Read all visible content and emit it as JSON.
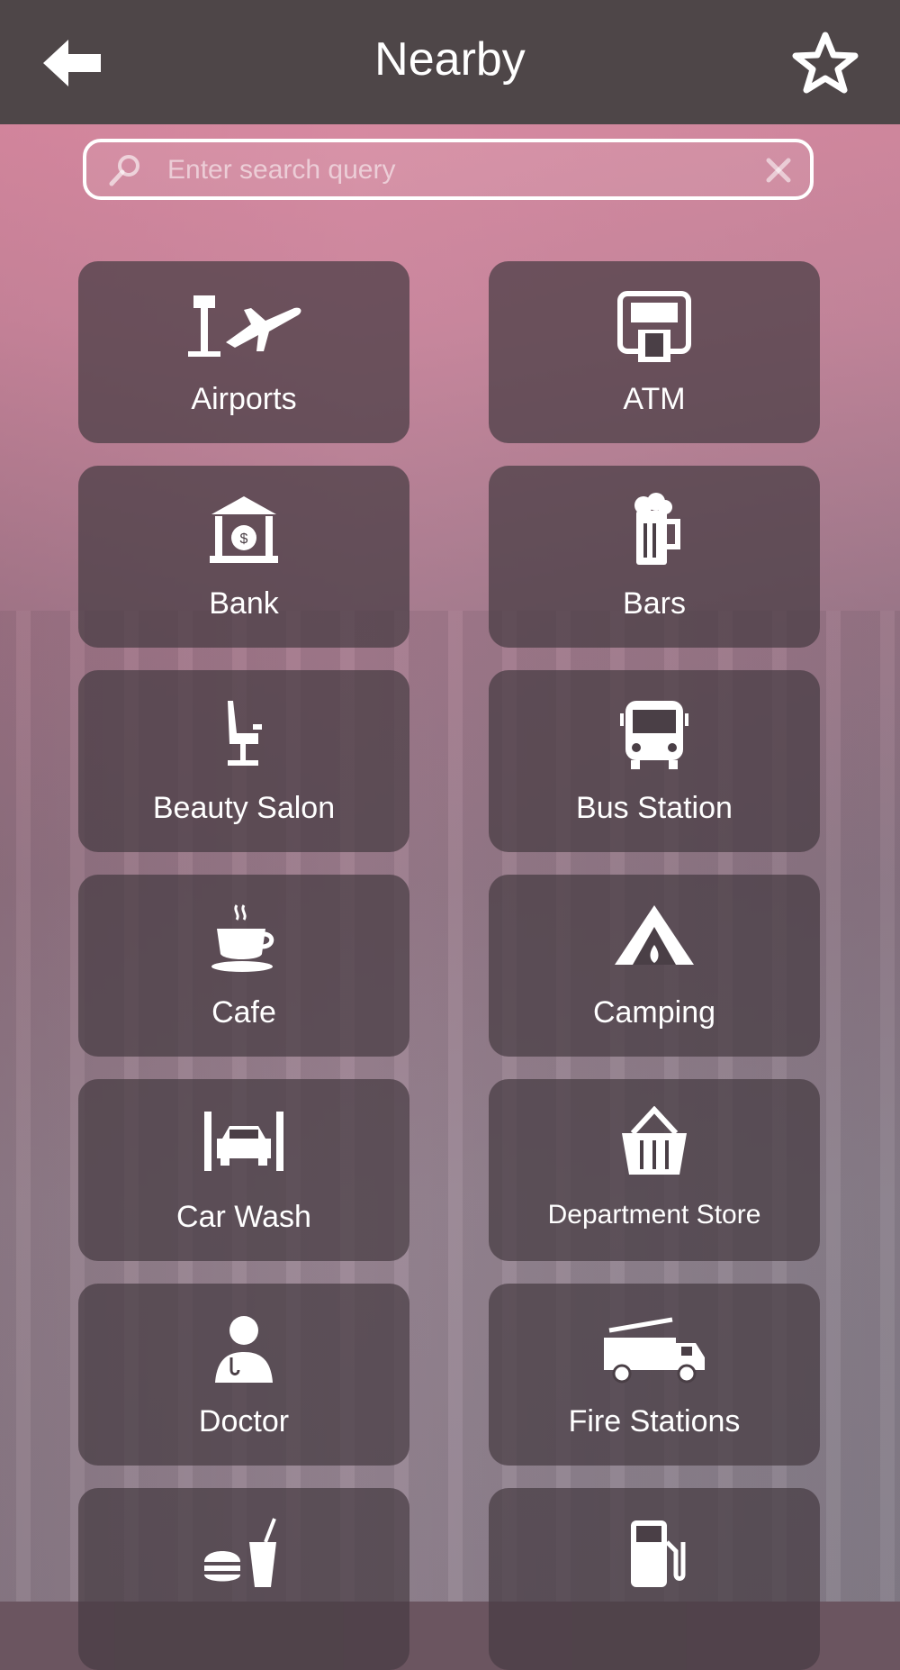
{
  "header": {
    "title": "Nearby"
  },
  "search": {
    "placeholder": "Enter search query",
    "value": ""
  },
  "categories": [
    {
      "label": "Airports",
      "icon": "airport-icon"
    },
    {
      "label": "ATM",
      "icon": "atm-icon"
    },
    {
      "label": "Bank",
      "icon": "bank-icon"
    },
    {
      "label": "Bars",
      "icon": "beer-mug-icon"
    },
    {
      "label": "Beauty Salon",
      "icon": "salon-chair-icon"
    },
    {
      "label": "Bus Station",
      "icon": "bus-icon"
    },
    {
      "label": "Cafe",
      "icon": "coffee-cup-icon"
    },
    {
      "label": "Camping",
      "icon": "tent-icon"
    },
    {
      "label": "Car Wash",
      "icon": "car-wash-icon"
    },
    {
      "label": "Department Store",
      "icon": "basket-icon"
    },
    {
      "label": "Doctor",
      "icon": "doctor-icon"
    },
    {
      "label": "Fire Stations",
      "icon": "fire-truck-icon"
    },
    {
      "label": "",
      "icon": "fast-food-icon"
    },
    {
      "label": "",
      "icon": "gas-pump-icon"
    }
  ]
}
